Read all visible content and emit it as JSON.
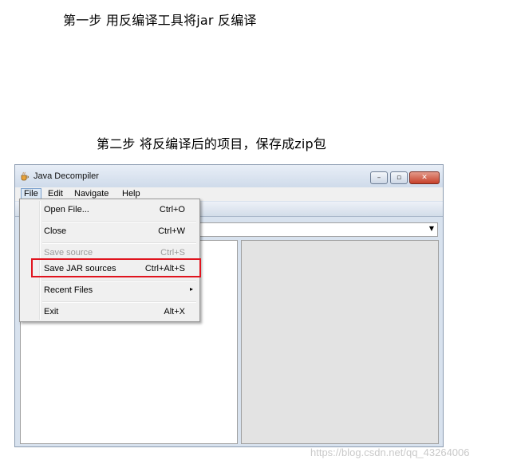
{
  "steps": {
    "step1": "第一步 用反编译工具将jar 反编译",
    "step2": "第二步 将反编译后的项目，保存成zip包"
  },
  "window": {
    "title": "Java Decompiler",
    "controls": {
      "minimize": "–",
      "maximize": "▫",
      "close": "✕"
    }
  },
  "menubar": {
    "file": "File",
    "edit": "Edit",
    "navigate": "Navigate",
    "help": "Help"
  },
  "file_menu": {
    "open_file": {
      "label": "Open File...",
      "shortcut": "Ctrl+O"
    },
    "close": {
      "label": "Close",
      "shortcut": "Ctrl+W"
    },
    "save_source": {
      "label": "Save source",
      "shortcut": "Ctrl+S"
    },
    "save_jar_sources": {
      "label": "Save JAR sources",
      "shortcut": "Ctrl+Alt+S"
    },
    "recent_files": {
      "label": "Recent Files",
      "arrow": "▸"
    },
    "exit": {
      "label": "Exit",
      "shortcut": "Alt+X"
    }
  },
  "combo": {
    "arrow": "▼"
  },
  "watermark": "https://blog.csdn.net/qq_43264006",
  "colors": {
    "highlight": "#e0141e",
    "menu_bg": "#f0f0f0",
    "window_frame": "#d8e2ee"
  }
}
